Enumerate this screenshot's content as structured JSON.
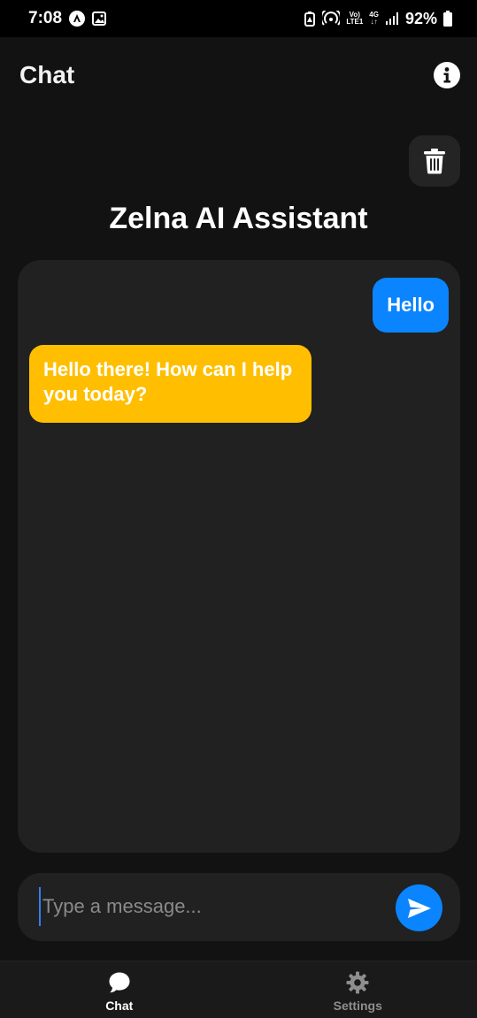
{
  "status_bar": {
    "time": "7:08",
    "volte_top": "Vo)",
    "volte_bottom": "LTE1",
    "network_top": "4G",
    "network_bottom": "↓↑",
    "battery": "92%"
  },
  "header": {
    "title": "Chat",
    "info_icon": "info-icon"
  },
  "main": {
    "delete_icon": "trash-icon",
    "assistant_title": "Zelna AI Assistant"
  },
  "messages": [
    {
      "role": "user",
      "text": "Hello"
    },
    {
      "role": "assistant",
      "text": "Hello there! How can I help you today?"
    }
  ],
  "input": {
    "placeholder": "Type a message...",
    "value": "",
    "send_icon": "send-icon"
  },
  "bottom_nav": {
    "items": [
      {
        "label": "Chat",
        "icon": "chat-bubble-icon",
        "active": true
      },
      {
        "label": "Settings",
        "icon": "gear-icon",
        "active": false
      }
    ]
  },
  "colors": {
    "background": "#121212",
    "panel": "#212121",
    "user_bubble": "#0a84ff",
    "assistant_bubble": "#ffbf00",
    "inactive_nav": "#8e8e8e"
  }
}
